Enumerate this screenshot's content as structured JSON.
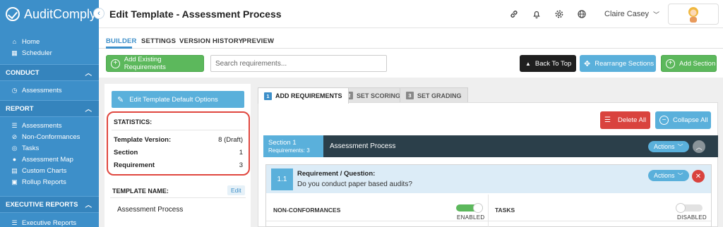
{
  "sidebar": {
    "brand": "AuditComply",
    "top_links": [
      {
        "label": "Home",
        "icon": "home-icon"
      },
      {
        "label": "Scheduler",
        "icon": "calendar-icon"
      }
    ],
    "sections": [
      {
        "title": "CONDUCT",
        "items": [
          {
            "label": "Assessments",
            "icon": "clock-icon"
          }
        ]
      },
      {
        "title": "REPORT",
        "items": [
          {
            "label": "Assessments",
            "icon": "list-icon"
          },
          {
            "label": "Non-Conformances",
            "icon": "warning-icon"
          },
          {
            "label": "Tasks",
            "icon": "target-icon"
          },
          {
            "label": "Assessment Map",
            "icon": "map-pin-icon"
          },
          {
            "label": "Custom Charts",
            "icon": "chart-icon"
          },
          {
            "label": "Rollup Reports",
            "icon": "image-icon"
          }
        ]
      },
      {
        "title": "EXECUTIVE REPORTS",
        "items": [
          {
            "label": "Executive Reports",
            "icon": "list-icon"
          }
        ]
      }
    ]
  },
  "header": {
    "title": "Edit Template - Assessment Process",
    "user_name": "Claire Casey"
  },
  "tabs": [
    "BUILDER",
    "SETTINGS",
    "VERSION HISTORY",
    "PREVIEW"
  ],
  "toolbar": {
    "add_existing": "Add Existing Requirements",
    "search_placeholder": "Search requirements...",
    "back_to_top": "Back To Top",
    "rearrange": "Rearrange Sections",
    "add_section": "Add Section"
  },
  "left_panel": {
    "edit_default": "Edit Template Default Options",
    "statistics_title": "STATISTICS:",
    "stats": [
      {
        "label": "Template Version:",
        "value": "8 (Draft)"
      },
      {
        "label": "Section",
        "value": "1"
      },
      {
        "label": "Requirement",
        "value": "3"
      }
    ],
    "template_name_title": "TEMPLATE NAME:",
    "edit_label": "Edit",
    "template_name": "Assessment Process"
  },
  "steps": [
    {
      "num": "1",
      "label": "ADD REQUIREMENTS"
    },
    {
      "num": "2",
      "label": "SET SCORING"
    },
    {
      "num": "3",
      "label": "SET GRADING"
    }
  ],
  "actions": {
    "delete_all": "Delete All",
    "collapse_all": "Collapse All"
  },
  "section": {
    "label": "Section 1",
    "sub": "Requirements: 3",
    "name": "Assessment Process",
    "actions": "Actions"
  },
  "requirement": {
    "number": "1.1",
    "title": "Requirement / Question:",
    "question": "Do you conduct paper based audits?",
    "actions": "Actions",
    "nc_label": "NON-CONFORMANCES",
    "nc_state": "ENABLED",
    "tasks_label": "TASKS",
    "tasks_state": "DISABLED"
  },
  "colors": {
    "sidebar": "#3d8fc9",
    "green": "#5cb85c",
    "blue": "#5ab0db",
    "red": "#d9433e",
    "dark": "#2b3f4a"
  }
}
